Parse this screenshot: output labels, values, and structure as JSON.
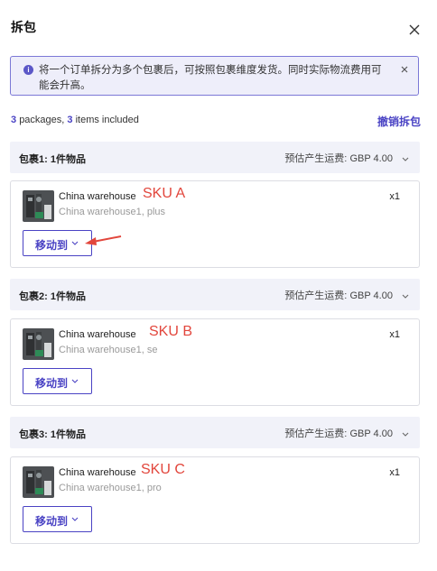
{
  "dialog": {
    "title": "拆包",
    "close_icon": "close-icon"
  },
  "info": {
    "icon": "info-icon",
    "icon_glyph": "i",
    "text": "将一个订单拆分为多个包裹后，可按照包裹维度发货。同时实际物流费用可能会升高。",
    "close_icon": "close-icon"
  },
  "summary": {
    "package_count": "3",
    "packages_word": "packages,",
    "item_count": "3",
    "items_word": "items included",
    "undo_label": "撤销拆包"
  },
  "packages": [
    {
      "title": "包裹1: 1件物品",
      "shipping_label": "预估产生运费:",
      "shipping_value": "GBP 4.00",
      "item_name": "China warehouse",
      "item_sub": "China warehouse1, plus",
      "qty": "x1",
      "sku_annotation": "SKU A",
      "move_label": "移动到"
    },
    {
      "title": "包裹2: 1件物品",
      "shipping_label": "预估产生运费:",
      "shipping_value": "GBP 4.00",
      "item_name": "China warehouse",
      "item_sub": "China warehouse1, se",
      "qty": "x1",
      "sku_annotation": "SKU B",
      "move_label": "移动到"
    },
    {
      "title": "包裹3: 1件物品",
      "shipping_label": "预估产生运费:",
      "shipping_value": "GBP 4.00",
      "item_name": "China warehouse",
      "item_sub": "China warehouse1, pro",
      "qty": "x1",
      "sku_annotation": "SKU C",
      "move_label": "移动到"
    }
  ],
  "colors": {
    "accent": "#4a43c4",
    "info_bg": "#eeeefa",
    "info_border": "#7b78d6",
    "package_header_bg": "#f1f2f9",
    "annotation_red": "#e2463c"
  }
}
